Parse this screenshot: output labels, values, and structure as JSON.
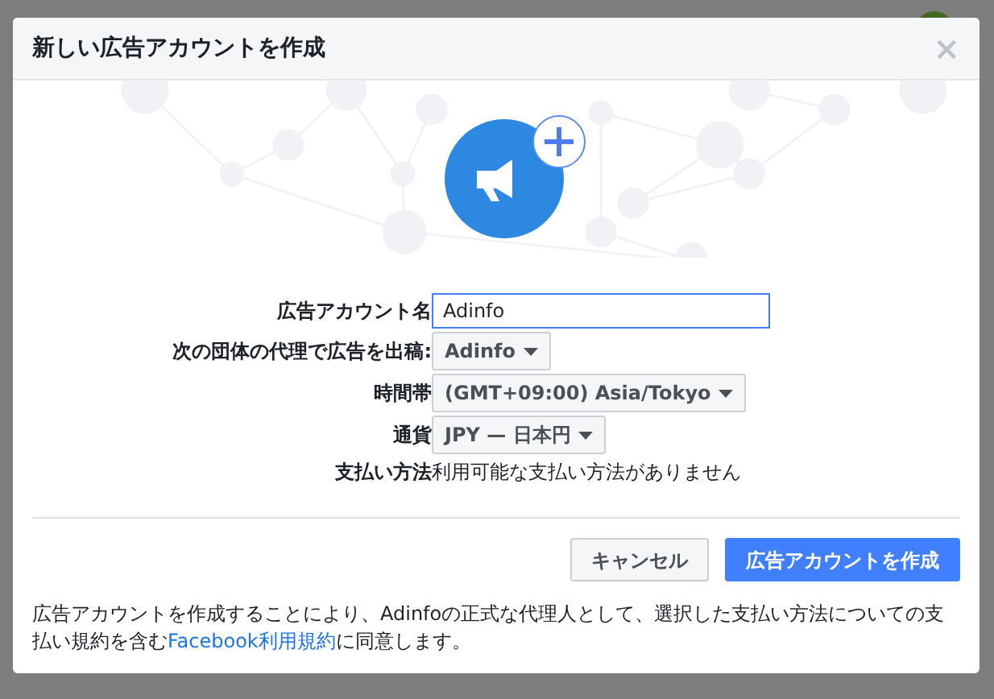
{
  "dialog": {
    "title": "新しい広告アカウントを作成",
    "close": "×"
  },
  "form": [
    {
      "kind": "input",
      "label": "広告アカウント名",
      "value": "Adinfo",
      "focused": true
    },
    {
      "kind": "select",
      "label": "次の団体の代理で広告を出稿:",
      "value": "Adinfo"
    },
    {
      "kind": "select",
      "label": "時間帯",
      "value": "(GMT+09:00) Asia/Tokyo"
    },
    {
      "kind": "select",
      "label": "通貨",
      "value": "JPY — 日本円"
    },
    {
      "kind": "text",
      "label": "支払い方法",
      "value": "利用可能な支払い方法がありません"
    }
  ],
  "buttons": [
    {
      "label": "キャンセル",
      "primary": false
    },
    {
      "label": "広告アカウントを作成",
      "primary": true
    }
  ],
  "terms": {
    "before": "広告アカウントを作成することにより、Adinfoの正式な代理人として、選択した支払い方法についての支払い規約を含む",
    "link": "Facebook利用規約",
    "after": "に同意します。"
  }
}
